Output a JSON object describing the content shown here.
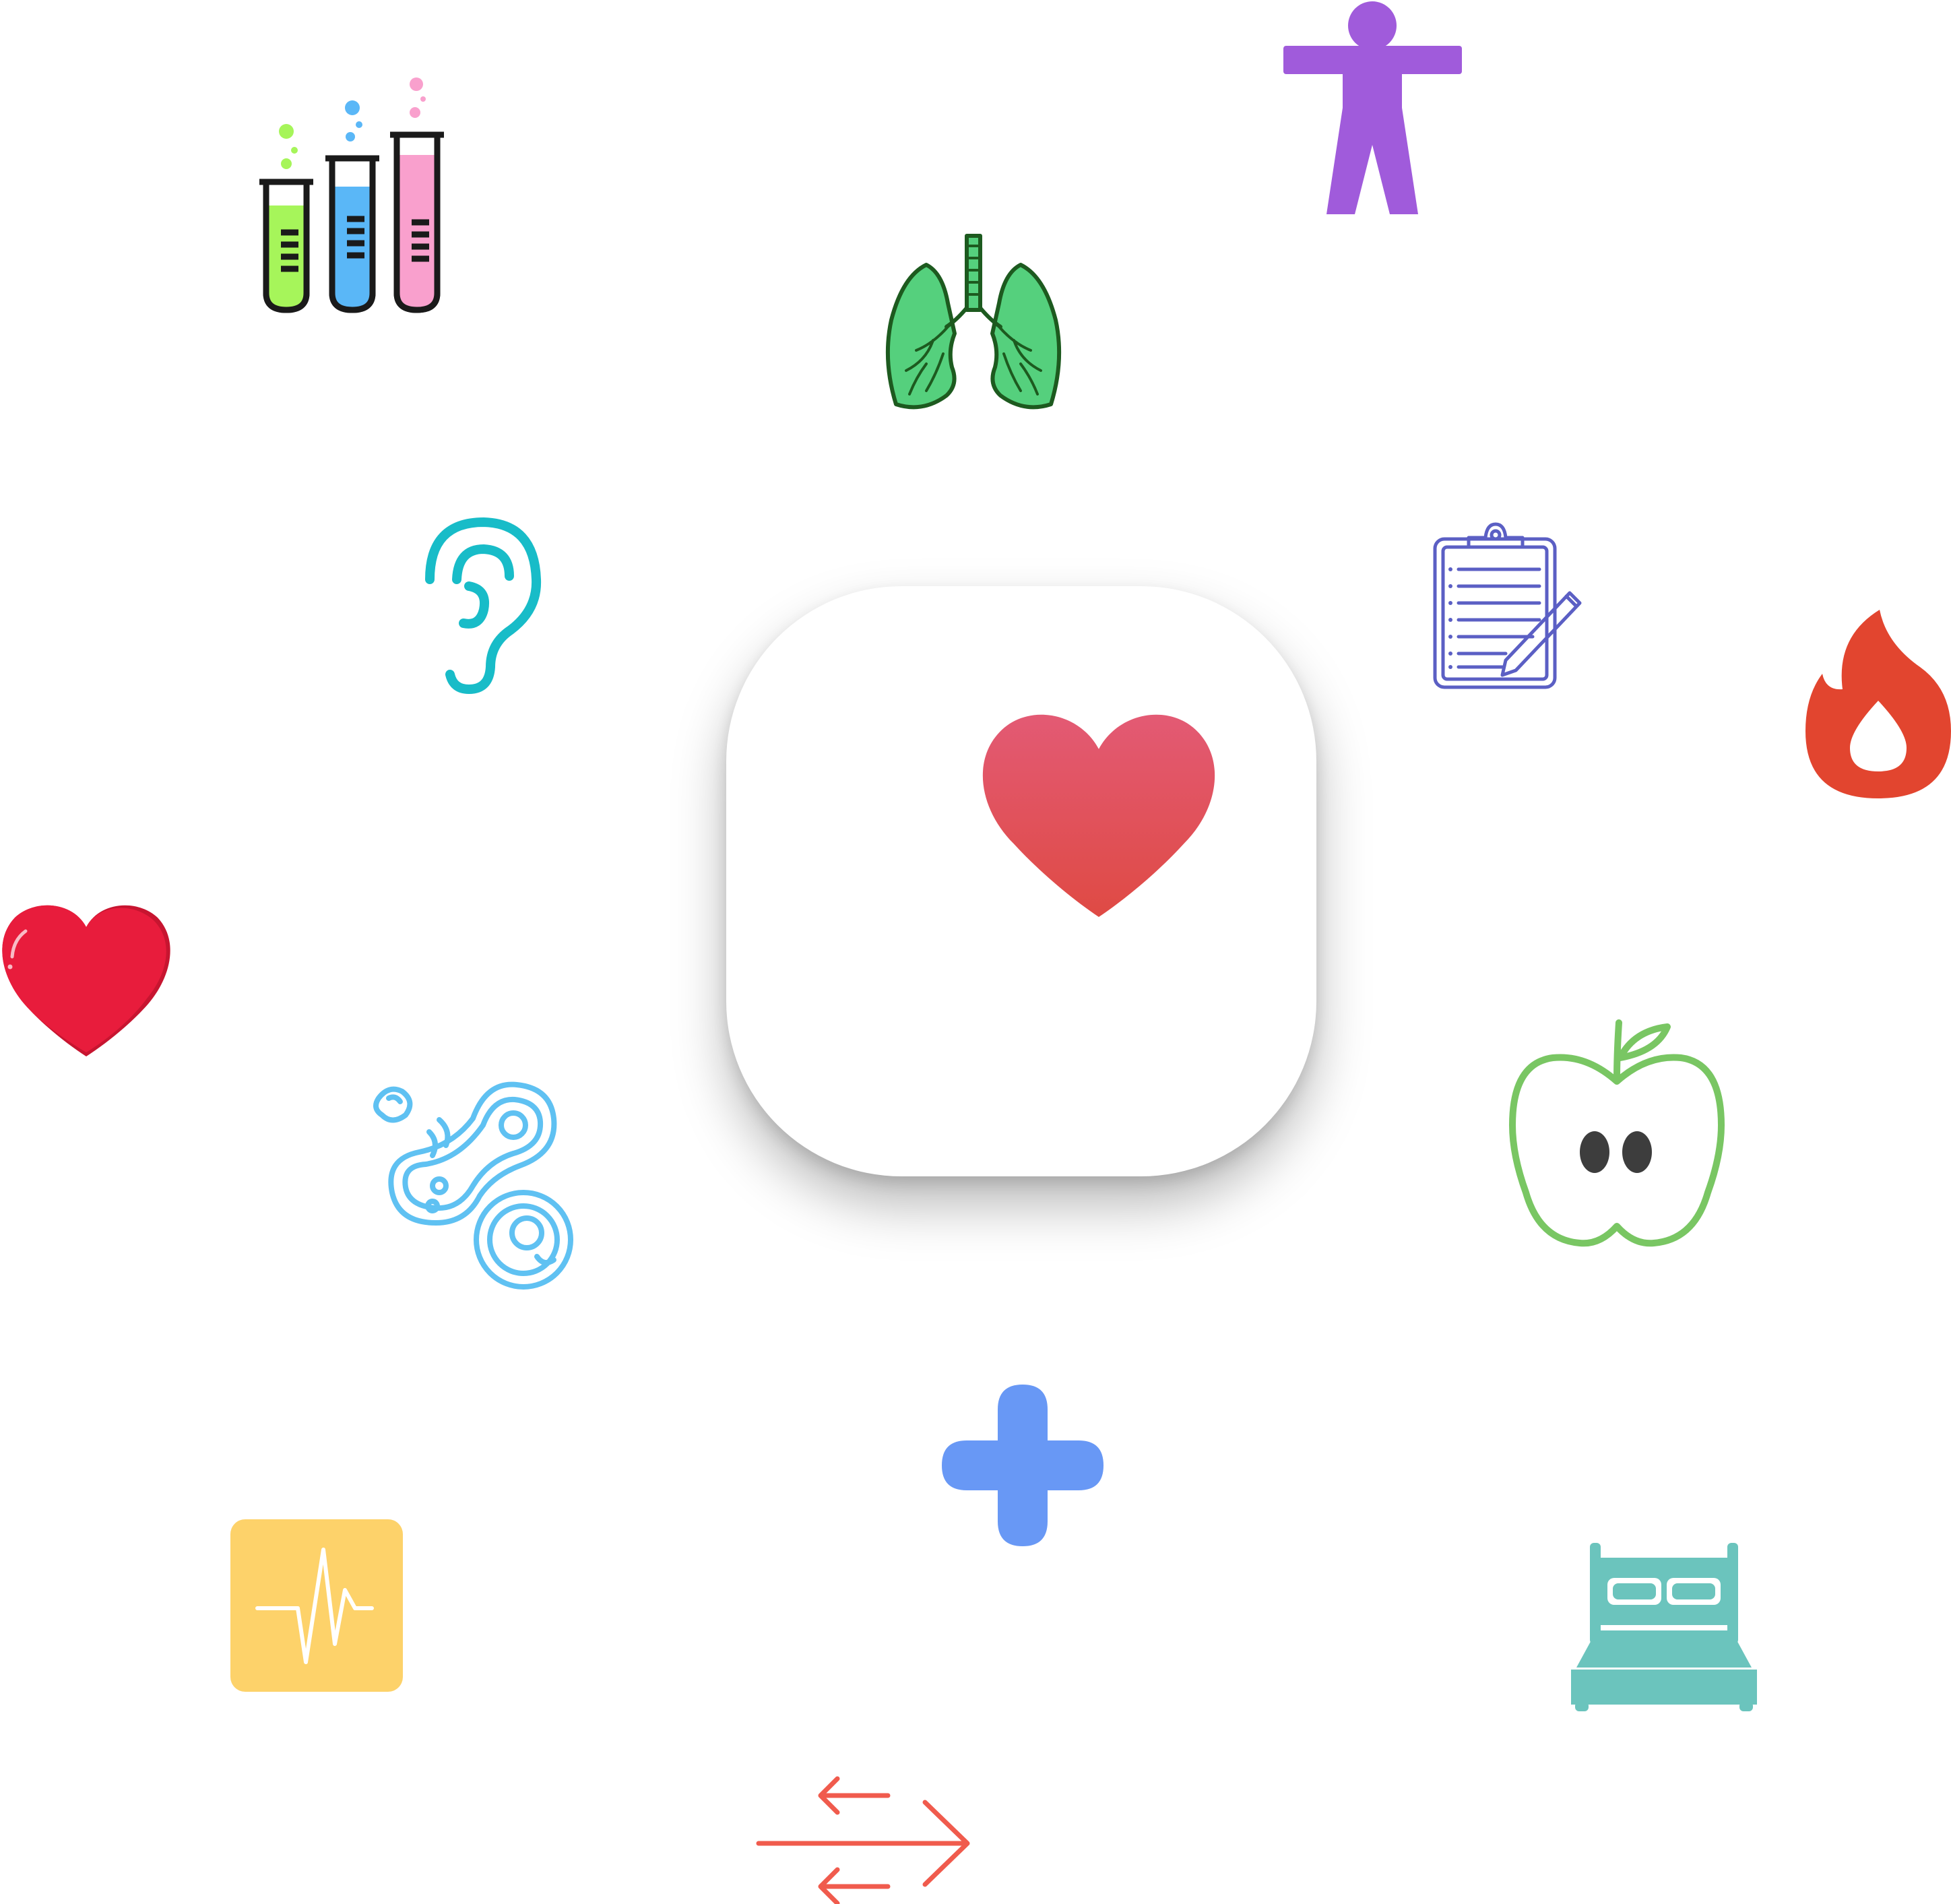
{
  "colors": {
    "background": "#ffffff",
    "tile": "#ffffff",
    "app_heart_top": "#e35a74",
    "app_heart_bottom": "#df4a44",
    "red_heart": "#e81c3c",
    "lungs_fill": "#55d07d",
    "lungs_stroke": "#1d5a1f",
    "body_figure": "#a05bdb",
    "ear": "#18bcc8",
    "clipboard": "#5b5fc4",
    "flame": "#e2452f",
    "cells": "#5fc1f2",
    "apple": "#79c663",
    "apple_seeds": "#3d3d3d",
    "plus": "#6898f5",
    "ecg_tile": "#fdd26a",
    "bed": "#6bc4bd",
    "transfer_arrows": "#f05b4d",
    "tube_green": "#a6f55a",
    "tube_blue": "#5ab7f7",
    "tube_pink": "#f9a0cd",
    "tube_outline": "#1a1a1a"
  },
  "icons": [
    "heart-app-icon",
    "test-tubes-icon",
    "lungs-icon",
    "body-figure-icon",
    "ear-icon",
    "clipboard-icon",
    "flame-icon",
    "heart-icon",
    "cells-icon",
    "apple-icon",
    "plus-icon",
    "ecg-icon",
    "bed-icon",
    "transfer-arrows-icon"
  ]
}
